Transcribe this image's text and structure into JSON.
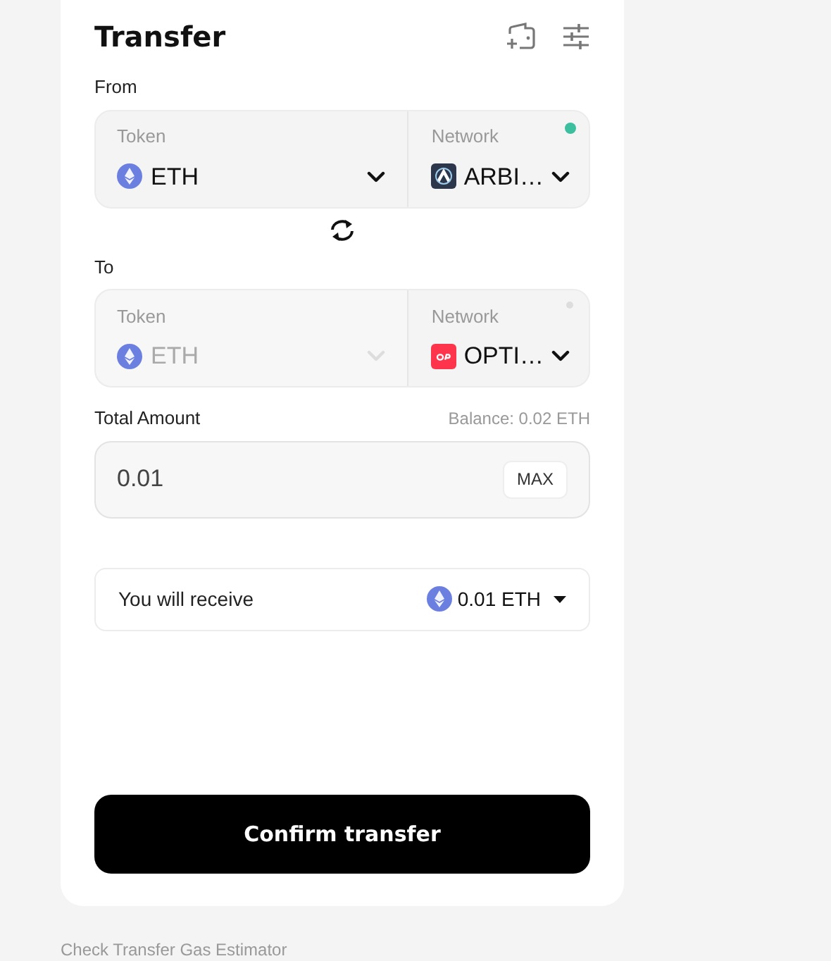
{
  "title": "Transfer",
  "from": {
    "label": "From",
    "token_label": "Token",
    "token": "ETH",
    "token_disabled": false,
    "network_label": "Network",
    "network": {
      "name": "ARBI…",
      "kind": "arbitrum"
    },
    "connected": true
  },
  "to": {
    "label": "To",
    "token_label": "Token",
    "token": "ETH",
    "token_disabled": true,
    "network_label": "Network",
    "network": {
      "name": "OPTI…",
      "kind": "optimism"
    },
    "connected": false
  },
  "amount": {
    "label": "Total Amount",
    "balance": "Balance: 0.02 ETH",
    "value": "0.01",
    "max_button": "MAX"
  },
  "receive": {
    "label": "You will receive",
    "value": "0.01 ETH"
  },
  "confirm_button": "Confirm transfer",
  "footer_link": "Check Transfer Gas Estimator"
}
